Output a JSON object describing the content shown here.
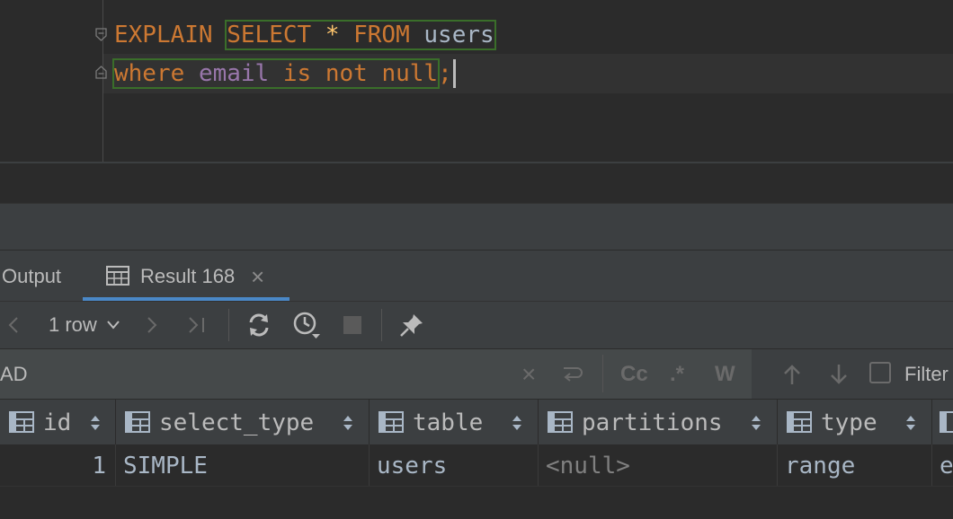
{
  "editor": {
    "line1": {
      "kw_explain": "EXPLAIN",
      "kw_select": "SELECT",
      "star": "*",
      "kw_from": "FROM",
      "table": "users"
    },
    "line2": {
      "kw_where": "where",
      "column": "email",
      "kw_is_not_null": "is not null",
      "semicolon": ";"
    }
  },
  "tabs": {
    "output": "Output",
    "result": "Result 168",
    "result_close": "×"
  },
  "toolbar": {
    "row_count": "1 row",
    "icons": [
      "chevron-left-icon",
      "chevron-down-icon",
      "chevron-right-icon",
      "last-page-icon",
      "refresh-icon",
      "history-icon",
      "stop-icon",
      "pin-icon"
    ]
  },
  "filter": {
    "text": "AD",
    "clear": "×",
    "match_case": "Cc",
    "regex": ".*",
    "words": "W",
    "label": "Filter"
  },
  "grid": {
    "columns": [
      "id",
      "select_type",
      "table",
      "partitions",
      "type"
    ],
    "rows": [
      {
        "id": "1",
        "select_type": "SIMPLE",
        "table": "users",
        "partitions": "<null>",
        "type": "range",
        "overflow": "e"
      }
    ]
  },
  "colors": {
    "keyword": "#cc7832",
    "identifier": "#a9b7c6",
    "function": "#9876aa",
    "star": "#ffc66d",
    "highlight_box": "#3a6e2a",
    "accent_tab": "#4a88c7"
  }
}
